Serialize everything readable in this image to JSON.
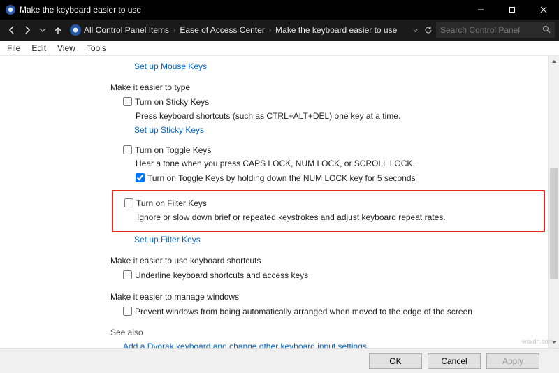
{
  "titlebar": {
    "title": "Make the keyboard easier to use"
  },
  "breadcrumb": {
    "item1": "All Control Panel Items",
    "item2": "Ease of Access Center",
    "item3": "Make the keyboard easier to use"
  },
  "search": {
    "placeholder": "Search Control Panel"
  },
  "menu": {
    "file": "File",
    "edit": "Edit",
    "view": "View",
    "tools": "Tools"
  },
  "links": {
    "mouseKeys": "Set up Mouse Keys",
    "stickyKeys": "Set up Sticky Keys",
    "filterKeys": "Set up Filter Keys",
    "seeAlsoDvorak": "Add a Dvorak keyboard and change other keyboard input settings"
  },
  "sections": {
    "typeEasier": "Make it easier to type",
    "shortcuts": "Make it easier to use keyboard shortcuts",
    "manageWindows": "Make it easier to manage windows",
    "seeAlso": "See also"
  },
  "checkboxes": {
    "sticky": {
      "label": "Turn on Sticky Keys",
      "desc": "Press keyboard shortcuts (such as CTRL+ALT+DEL) one key at a time."
    },
    "toggle": {
      "label": "Turn on Toggle Keys",
      "desc": "Hear a tone when you press CAPS LOCK, NUM LOCK, or SCROLL LOCK.",
      "sub": "Turn on Toggle Keys by holding down the NUM LOCK key for 5 seconds"
    },
    "filter": {
      "label": "Turn on Filter Keys",
      "desc": "Ignore or slow down brief or repeated keystrokes and adjust keyboard repeat rates."
    },
    "underline": {
      "label": "Underline keyboard shortcuts and access keys"
    },
    "preventArrange": {
      "label": "Prevent windows from being automatically arranged when moved to the edge of the screen"
    }
  },
  "buttons": {
    "ok": "OK",
    "cancel": "Cancel",
    "apply": "Apply"
  },
  "watermark": "wsxdn.com"
}
